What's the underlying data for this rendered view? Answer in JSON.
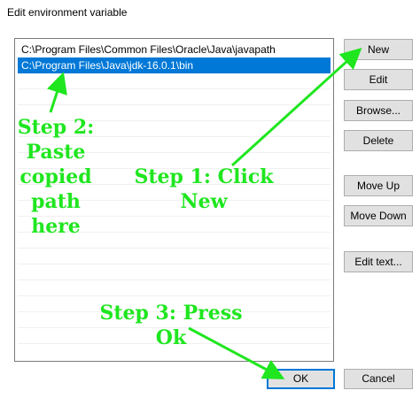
{
  "window": {
    "title": "Edit environment variable"
  },
  "list": {
    "items": [
      "C:\\Program Files\\Common Files\\Oracle\\Java\\javapath",
      "C:\\Program Files\\Java\\jdk-16.0.1\\bin"
    ],
    "selected_index": 1
  },
  "buttons": {
    "new": "New",
    "edit": "Edit",
    "browse": "Browse...",
    "delete": "Delete",
    "move_up": "Move Up",
    "move_down": "Move Down",
    "edit_text": "Edit text...",
    "ok": "OK",
    "cancel": "Cancel"
  },
  "annotations": {
    "step1": [
      "Step 1: Click",
      "New"
    ],
    "step2": [
      "Step 2:",
      "Paste",
      "copied",
      "path",
      "here"
    ],
    "step3": [
      "Step 3: Press",
      "Ok"
    ],
    "color": "#1fe61f"
  },
  "colors": {
    "selection": "#0078d7",
    "button_face": "#e1e1e1",
    "button_border": "#adadad",
    "annotation": "#1fe61f"
  },
  "icons": {
    "arrow": "arrow-icon"
  }
}
